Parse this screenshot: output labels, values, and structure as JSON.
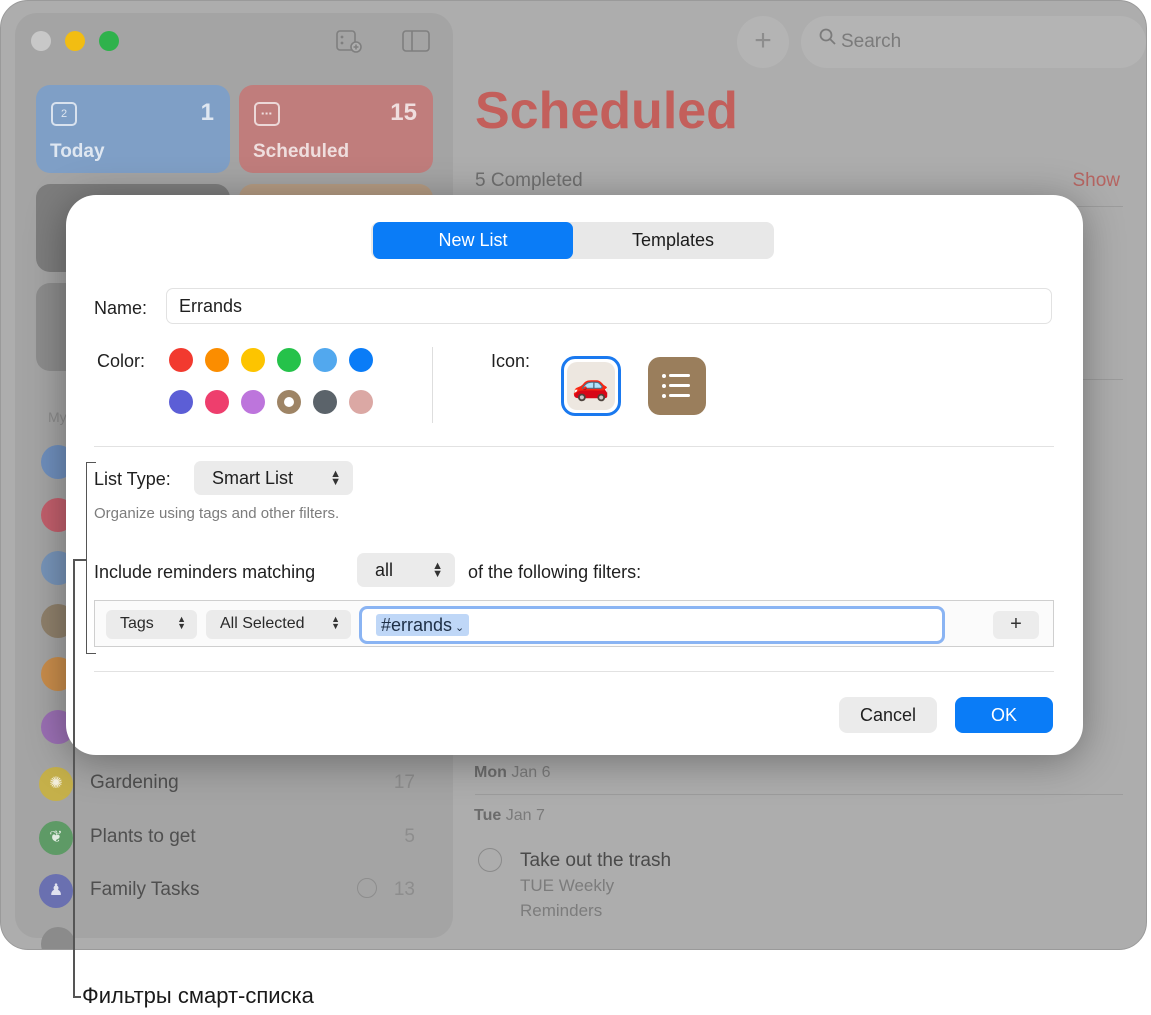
{
  "background": {
    "sidebar": {
      "tiles": [
        {
          "label": "Today",
          "count": "1",
          "color": "#7f9fc6",
          "icon": "calendar-today-icon",
          "icon_text": "2"
        },
        {
          "label": "Scheduled",
          "count": "15",
          "color": "#c07d7c",
          "icon": "calendar-icon",
          "icon_text": ""
        }
      ],
      "section_header": "My",
      "lists": [
        {
          "name": "Gardening",
          "count": "17",
          "color": "#c5b04a",
          "icon": "sun-icon"
        },
        {
          "name": "Plants to get",
          "count": "5",
          "color": "#5e9a66",
          "icon": "leaf-icon"
        },
        {
          "name": "Family Tasks",
          "count": "13",
          "color": "#6a70b0",
          "icon": "family-icon"
        }
      ]
    },
    "main": {
      "search_placeholder": "Search",
      "title": "Scheduled",
      "completed_text": "5 Completed",
      "show_label": "Show",
      "days": [
        {
          "weekday": "Mon",
          "date": "Jan 6"
        },
        {
          "weekday": "Tue",
          "date": "Jan 7"
        }
      ],
      "task": {
        "title": "Take out the trash",
        "line1": "TUE Weekly",
        "line2": "Reminders"
      }
    }
  },
  "dialog": {
    "tabs": [
      {
        "label": "New List",
        "active": true
      },
      {
        "label": "Templates",
        "active": false
      }
    ],
    "name_label": "Name:",
    "name_value": "Errands",
    "color_label": "Color:",
    "colors": [
      "#f23a2f",
      "#fb8d00",
      "#fdc400",
      "#25c24a",
      "#52a8ee",
      "#0a7cf7",
      "#5c5ed6",
      "#ee3e6d",
      "#bd75dc",
      "#9e8465",
      "#5b636a",
      "#dba8a4"
    ],
    "selected_color": "#9e8465",
    "icon_label": "Icon:",
    "icons": [
      {
        "name": "car-icon",
        "glyph": "🚗",
        "selected": true
      },
      {
        "name": "list-bullet-icon",
        "glyph": "",
        "selected": false
      }
    ],
    "list_type_label": "List Type:",
    "list_type_value": "Smart List",
    "list_type_hint": "Organize using tags and other filters.",
    "include_prefix": "Include reminders matching",
    "match_value": "all",
    "include_suffix": "of the following filters:",
    "filter": {
      "field": "Tags",
      "operator": "All Selected",
      "token": "#errands"
    },
    "add_filter_label": "+",
    "cancel_label": "Cancel",
    "ok_label": "OK"
  },
  "callout": {
    "caption": "Фильтры смарт-списка"
  }
}
